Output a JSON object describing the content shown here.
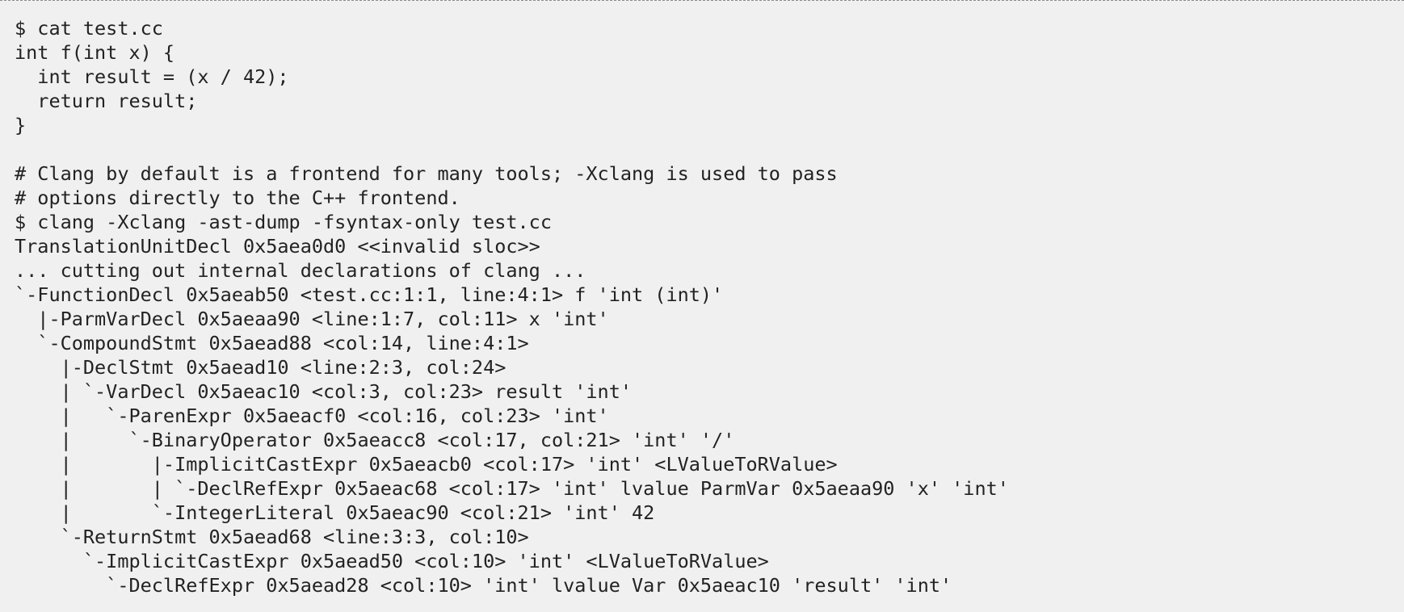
{
  "colors": {
    "background": "#f0f0f0",
    "text": "#222222"
  },
  "code": {
    "lines": [
      "$ cat test.cc",
      "int f(int x) {",
      "  int result = (x / 42);",
      "  return result;",
      "}",
      "",
      "# Clang by default is a frontend for many tools; -Xclang is used to pass",
      "# options directly to the C++ frontend.",
      "$ clang -Xclang -ast-dump -fsyntax-only test.cc",
      "TranslationUnitDecl 0x5aea0d0 <<invalid sloc>>",
      "... cutting out internal declarations of clang ...",
      "`-FunctionDecl 0x5aeab50 <test.cc:1:1, line:4:1> f 'int (int)'",
      "  |-ParmVarDecl 0x5aeaa90 <line:1:7, col:11> x 'int'",
      "  `-CompoundStmt 0x5aead88 <col:14, line:4:1>",
      "    |-DeclStmt 0x5aead10 <line:2:3, col:24>",
      "    | `-VarDecl 0x5aeac10 <col:3, col:23> result 'int'",
      "    |   `-ParenExpr 0x5aeacf0 <col:16, col:23> 'int'",
      "    |     `-BinaryOperator 0x5aeacc8 <col:17, col:21> 'int' '/'",
      "    |       |-ImplicitCastExpr 0x5aeacb0 <col:17> 'int' <LValueToRValue>",
      "    |       | `-DeclRefExpr 0x5aeac68 <col:17> 'int' lvalue ParmVar 0x5aeaa90 'x' 'int'",
      "    |       `-IntegerLiteral 0x5aeac90 <col:21> 'int' 42",
      "    `-ReturnStmt 0x5aead68 <line:3:3, col:10>",
      "      `-ImplicitCastExpr 0x5aead50 <col:10> 'int' <LValueToRValue>",
      "        `-DeclRefExpr 0x5aead28 <col:10> 'int' lvalue Var 0x5aeac10 'result' 'int'"
    ]
  }
}
